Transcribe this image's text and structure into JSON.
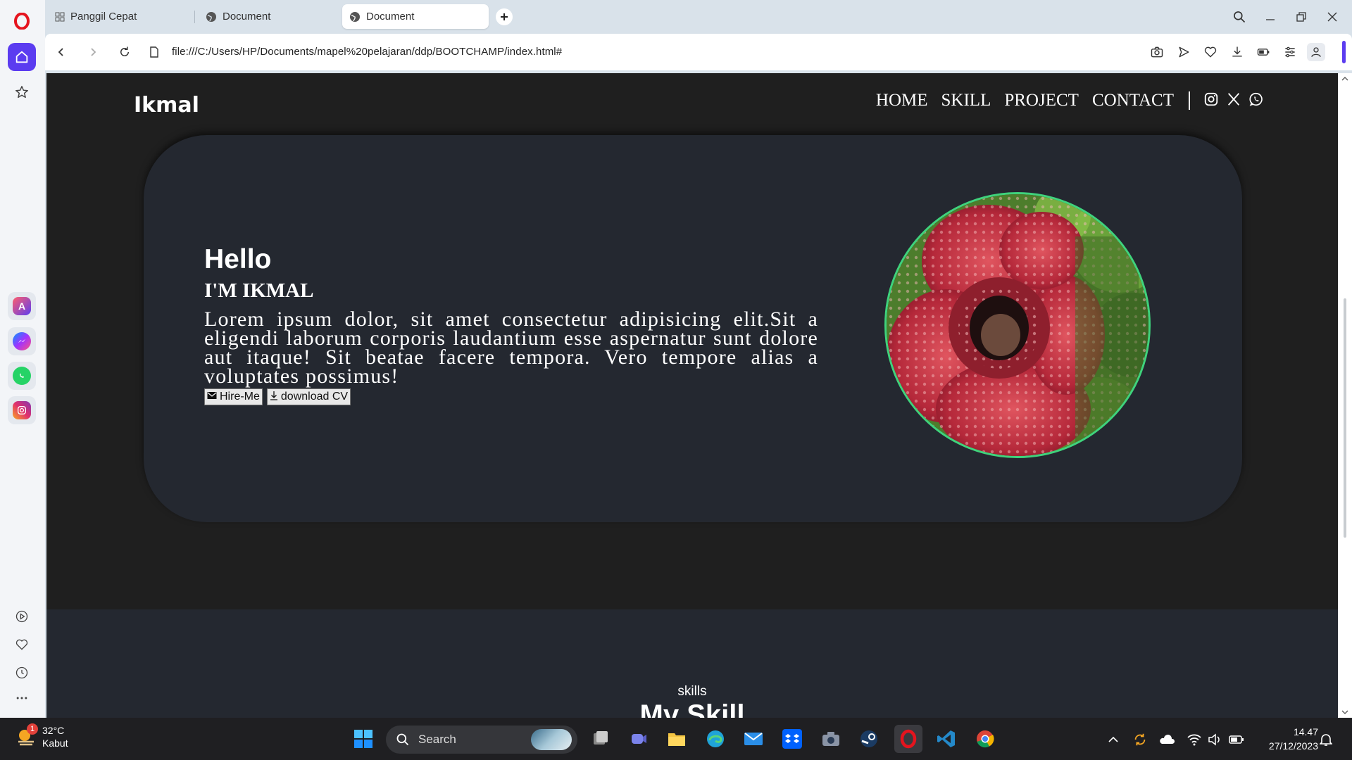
{
  "browser": {
    "tabs": [
      {
        "label": "Panggil Cepat",
        "active": false
      },
      {
        "label": "Document",
        "active": false
      },
      {
        "label": "Document",
        "active": true
      }
    ],
    "new_tab_icon": "plus-icon",
    "url": "file:///C:/Users/HP/Documents/mapel%20pelajaran/ddp/BOOTCHAMP/index.html#",
    "toolbar_icons": [
      "camera-icon",
      "send-icon",
      "heart-icon",
      "download-icon",
      "battery-saver-icon",
      "easy-setup-icon",
      "profile-icon"
    ],
    "accent": "#5b3cf0"
  },
  "sidebar": {
    "apps": [
      "aria-icon",
      "messenger-icon",
      "whatsapp-icon",
      "instagram-icon"
    ],
    "bottom": [
      "player-icon",
      "heart-icon",
      "history-icon",
      "more-icon"
    ]
  },
  "site": {
    "brand": "Ikmal",
    "nav": [
      "HOME",
      "SKILL",
      "PROJECT",
      "CONTACT"
    ],
    "social_icons": [
      "instagram-icon",
      "x-icon",
      "whatsapp-icon"
    ],
    "hero": {
      "hello": "Hello",
      "name": "I'M IKMAL",
      "description": "Lorem ipsum dolor, sit amet consectetur adipisicing elit.Sit a eligendi laborum corporis laudantium esse aspernatur sunt dolore aut itaque! Sit beatae facere tempora. Vero tempore alias a voluptates possimus!",
      "btn_hire": "Hire-Me",
      "btn_cv": "download CV",
      "photo": "rafflesia-flower-photo"
    },
    "skills": {
      "kicker": "skills",
      "title": "My Skill"
    },
    "colors": {
      "page_bg": "#1f1f1f",
      "card_bg": "#242830",
      "photo_ring": "#3fd37c"
    }
  },
  "taskbar": {
    "weather_temp": "32°C",
    "weather_desc": "Kabut",
    "weather_badge": "1",
    "search_label": "Search",
    "time": "14.47",
    "date": "27/12/2023"
  }
}
